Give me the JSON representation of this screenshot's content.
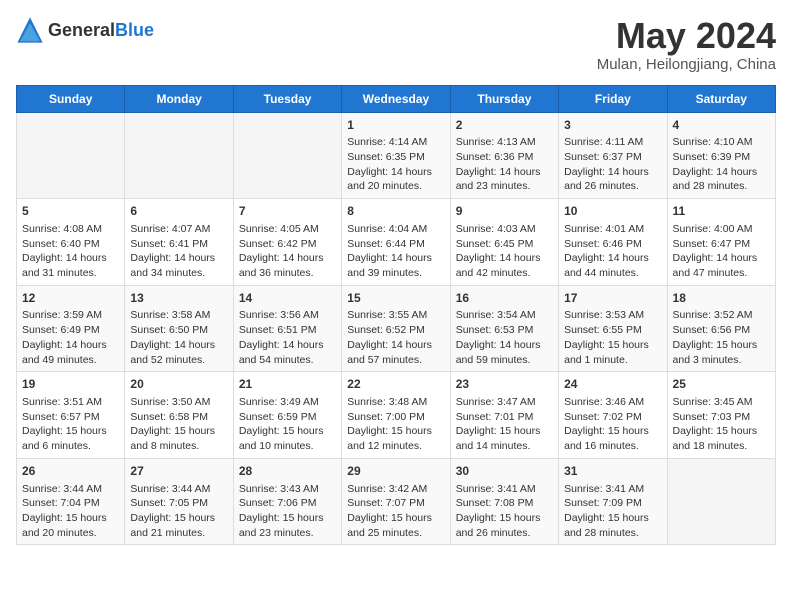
{
  "header": {
    "logo_general": "General",
    "logo_blue": "Blue",
    "main_title": "May 2024",
    "subtitle": "Mulan, Heilongjiang, China"
  },
  "days_of_week": [
    "Sunday",
    "Monday",
    "Tuesday",
    "Wednesday",
    "Thursday",
    "Friday",
    "Saturday"
  ],
  "weeks": [
    [
      {
        "day": "",
        "sunrise": "",
        "sunset": "",
        "daylight": "",
        "empty": true
      },
      {
        "day": "",
        "sunrise": "",
        "sunset": "",
        "daylight": "",
        "empty": true
      },
      {
        "day": "",
        "sunrise": "",
        "sunset": "",
        "daylight": "",
        "empty": true
      },
      {
        "day": "1",
        "sunrise": "Sunrise: 4:14 AM",
        "sunset": "Sunset: 6:35 PM",
        "daylight": "Daylight: 14 hours and 20 minutes."
      },
      {
        "day": "2",
        "sunrise": "Sunrise: 4:13 AM",
        "sunset": "Sunset: 6:36 PM",
        "daylight": "Daylight: 14 hours and 23 minutes."
      },
      {
        "day": "3",
        "sunrise": "Sunrise: 4:11 AM",
        "sunset": "Sunset: 6:37 PM",
        "daylight": "Daylight: 14 hours and 26 minutes."
      },
      {
        "day": "4",
        "sunrise": "Sunrise: 4:10 AM",
        "sunset": "Sunset: 6:39 PM",
        "daylight": "Daylight: 14 hours and 28 minutes."
      }
    ],
    [
      {
        "day": "5",
        "sunrise": "Sunrise: 4:08 AM",
        "sunset": "Sunset: 6:40 PM",
        "daylight": "Daylight: 14 hours and 31 minutes."
      },
      {
        "day": "6",
        "sunrise": "Sunrise: 4:07 AM",
        "sunset": "Sunset: 6:41 PM",
        "daylight": "Daylight: 14 hours and 34 minutes."
      },
      {
        "day": "7",
        "sunrise": "Sunrise: 4:05 AM",
        "sunset": "Sunset: 6:42 PM",
        "daylight": "Daylight: 14 hours and 36 minutes."
      },
      {
        "day": "8",
        "sunrise": "Sunrise: 4:04 AM",
        "sunset": "Sunset: 6:44 PM",
        "daylight": "Daylight: 14 hours and 39 minutes."
      },
      {
        "day": "9",
        "sunrise": "Sunrise: 4:03 AM",
        "sunset": "Sunset: 6:45 PM",
        "daylight": "Daylight: 14 hours and 42 minutes."
      },
      {
        "day": "10",
        "sunrise": "Sunrise: 4:01 AM",
        "sunset": "Sunset: 6:46 PM",
        "daylight": "Daylight: 14 hours and 44 minutes."
      },
      {
        "day": "11",
        "sunrise": "Sunrise: 4:00 AM",
        "sunset": "Sunset: 6:47 PM",
        "daylight": "Daylight: 14 hours and 47 minutes."
      }
    ],
    [
      {
        "day": "12",
        "sunrise": "Sunrise: 3:59 AM",
        "sunset": "Sunset: 6:49 PM",
        "daylight": "Daylight: 14 hours and 49 minutes."
      },
      {
        "day": "13",
        "sunrise": "Sunrise: 3:58 AM",
        "sunset": "Sunset: 6:50 PM",
        "daylight": "Daylight: 14 hours and 52 minutes."
      },
      {
        "day": "14",
        "sunrise": "Sunrise: 3:56 AM",
        "sunset": "Sunset: 6:51 PM",
        "daylight": "Daylight: 14 hours and 54 minutes."
      },
      {
        "day": "15",
        "sunrise": "Sunrise: 3:55 AM",
        "sunset": "Sunset: 6:52 PM",
        "daylight": "Daylight: 14 hours and 57 minutes."
      },
      {
        "day": "16",
        "sunrise": "Sunrise: 3:54 AM",
        "sunset": "Sunset: 6:53 PM",
        "daylight": "Daylight: 14 hours and 59 minutes."
      },
      {
        "day": "17",
        "sunrise": "Sunrise: 3:53 AM",
        "sunset": "Sunset: 6:55 PM",
        "daylight": "Daylight: 15 hours and 1 minute."
      },
      {
        "day": "18",
        "sunrise": "Sunrise: 3:52 AM",
        "sunset": "Sunset: 6:56 PM",
        "daylight": "Daylight: 15 hours and 3 minutes."
      }
    ],
    [
      {
        "day": "19",
        "sunrise": "Sunrise: 3:51 AM",
        "sunset": "Sunset: 6:57 PM",
        "daylight": "Daylight: 15 hours and 6 minutes."
      },
      {
        "day": "20",
        "sunrise": "Sunrise: 3:50 AM",
        "sunset": "Sunset: 6:58 PM",
        "daylight": "Daylight: 15 hours and 8 minutes."
      },
      {
        "day": "21",
        "sunrise": "Sunrise: 3:49 AM",
        "sunset": "Sunset: 6:59 PM",
        "daylight": "Daylight: 15 hours and 10 minutes."
      },
      {
        "day": "22",
        "sunrise": "Sunrise: 3:48 AM",
        "sunset": "Sunset: 7:00 PM",
        "daylight": "Daylight: 15 hours and 12 minutes."
      },
      {
        "day": "23",
        "sunrise": "Sunrise: 3:47 AM",
        "sunset": "Sunset: 7:01 PM",
        "daylight": "Daylight: 15 hours and 14 minutes."
      },
      {
        "day": "24",
        "sunrise": "Sunrise: 3:46 AM",
        "sunset": "Sunset: 7:02 PM",
        "daylight": "Daylight: 15 hours and 16 minutes."
      },
      {
        "day": "25",
        "sunrise": "Sunrise: 3:45 AM",
        "sunset": "Sunset: 7:03 PM",
        "daylight": "Daylight: 15 hours and 18 minutes."
      }
    ],
    [
      {
        "day": "26",
        "sunrise": "Sunrise: 3:44 AM",
        "sunset": "Sunset: 7:04 PM",
        "daylight": "Daylight: 15 hours and 20 minutes."
      },
      {
        "day": "27",
        "sunrise": "Sunrise: 3:44 AM",
        "sunset": "Sunset: 7:05 PM",
        "daylight": "Daylight: 15 hours and 21 minutes."
      },
      {
        "day": "28",
        "sunrise": "Sunrise: 3:43 AM",
        "sunset": "Sunset: 7:06 PM",
        "daylight": "Daylight: 15 hours and 23 minutes."
      },
      {
        "day": "29",
        "sunrise": "Sunrise: 3:42 AM",
        "sunset": "Sunset: 7:07 PM",
        "daylight": "Daylight: 15 hours and 25 minutes."
      },
      {
        "day": "30",
        "sunrise": "Sunrise: 3:41 AM",
        "sunset": "Sunset: 7:08 PM",
        "daylight": "Daylight: 15 hours and 26 minutes."
      },
      {
        "day": "31",
        "sunrise": "Sunrise: 3:41 AM",
        "sunset": "Sunset: 7:09 PM",
        "daylight": "Daylight: 15 hours and 28 minutes."
      },
      {
        "day": "",
        "sunrise": "",
        "sunset": "",
        "daylight": "",
        "empty": true
      }
    ]
  ]
}
